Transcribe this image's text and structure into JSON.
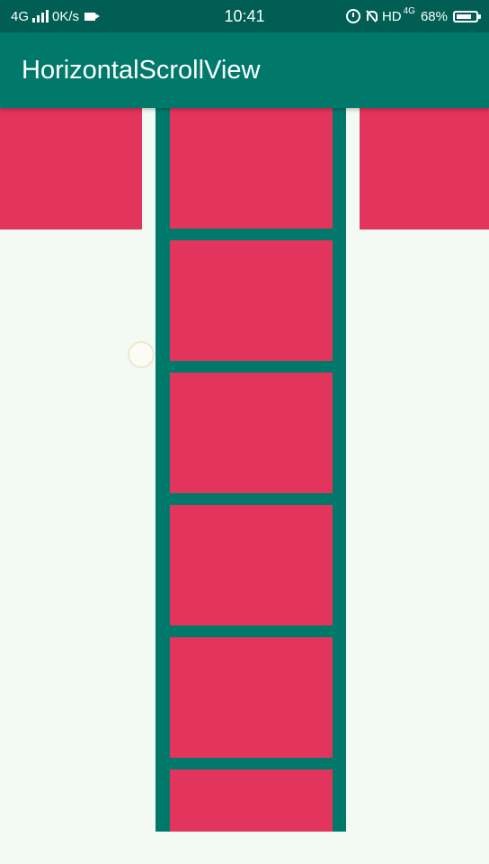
{
  "status_bar": {
    "network": "4G",
    "speed": "0K/s",
    "time": "10:41",
    "hd": "HD",
    "hd_network": "4G",
    "battery": "68%"
  },
  "app_bar": {
    "title": "HorizontalScrollView"
  },
  "colors": {
    "status_bar": "#005e55",
    "app_bar": "#00796b",
    "tile": "#e2345c",
    "background": "#f3faf4"
  }
}
